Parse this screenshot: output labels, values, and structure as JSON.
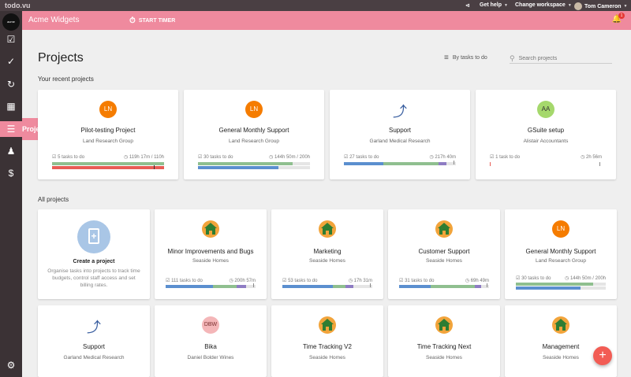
{
  "topbar": {
    "logo": "todo.vu",
    "share_icon": "share-icon",
    "help_label": "Get help",
    "workspace_label": "Change workspace",
    "user_name": "Tom Cameron"
  },
  "subbar": {
    "org_name": "Acme Widgets",
    "timer_label": "START TIMER",
    "bell_count": "1"
  },
  "sidebar": {
    "account_label": "acme",
    "active_label": "Projects"
  },
  "page": {
    "title": "Projects",
    "sort_label": "By tasks to do",
    "search_placeholder": "Search projects",
    "recent_heading": "Your recent projects",
    "all_heading": "All projects"
  },
  "recent": [
    {
      "initials": "LN",
      "name": "Pilot-testing Project",
      "client": "Land Research Group",
      "tasks": "5 tasks to do",
      "time": "119h 17m / 110h"
    },
    {
      "initials": "LN",
      "name": "General Monthly Support",
      "client": "Land Research Group",
      "tasks": "30 tasks to do",
      "time": "144h 50m / 200h"
    },
    {
      "initials": "",
      "name": "Support",
      "client": "Garland Medical Research",
      "tasks": "27 tasks to do",
      "time": "217h 40m"
    },
    {
      "initials": "AA",
      "name": "GSuite setup",
      "client": "Alistair Accountants",
      "tasks": "1 task to do",
      "time": "2h 56m"
    }
  ],
  "create": {
    "title": "Create a project",
    "desc": "Organise tasks into projects to track time budgets, control staff access and set billing rates."
  },
  "all": [
    {
      "name": "Minor Improvements and Bugs",
      "client": "Seaside Homes",
      "tasks": "111 tasks to do",
      "time": "200h 57m"
    },
    {
      "name": "Marketing",
      "client": "Seaside Homes",
      "tasks": "53 tasks to do",
      "time": "17h 31m"
    },
    {
      "name": "Customer Support",
      "client": "Seaside Homes",
      "tasks": "31 tasks to do",
      "time": "69h 49m"
    },
    {
      "initials": "LN",
      "name": "General Monthly Support",
      "client": "Land Research Group",
      "tasks": "30 tasks to do",
      "time": "144h 50m / 200h"
    }
  ],
  "row3": [
    {
      "name": "Support",
      "client": "Garland Medical Research"
    },
    {
      "initials": "DBW",
      "name": "Bika",
      "client": "Daniel Bolder Wines"
    },
    {
      "name": "Time Tracking V2",
      "client": "Seaside Homes"
    },
    {
      "name": "Time Tracking Next",
      "client": "Seaside Homes"
    },
    {
      "name": "Management",
      "client": "Seaside Homes"
    }
  ],
  "colors": {
    "accent": "#ef8a9e",
    "sidebar": "#3b3235",
    "orange_avatar": "#f57c00",
    "green_avatar": "#a5d86c",
    "pink_avatar": "#f4b6b8",
    "bar_blue": "#5b8fcf",
    "bar_green": "#8fbf8f",
    "bar_purple": "#8e7cc3",
    "bar_red": "#e85c55"
  }
}
